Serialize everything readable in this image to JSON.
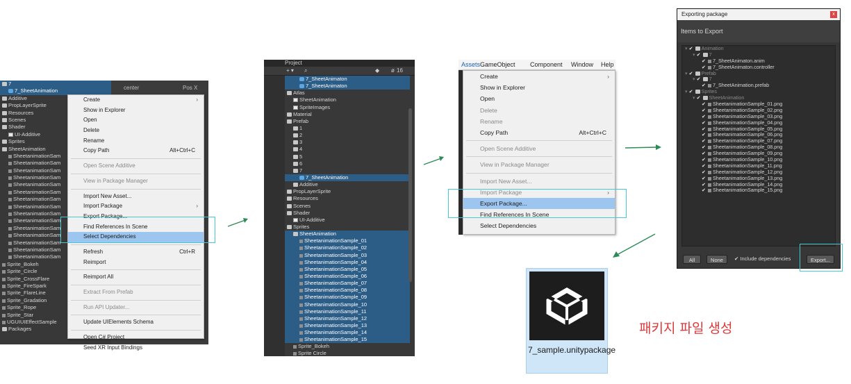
{
  "panel1": {
    "tree": [
      {
        "label": "7",
        "icon": "folder",
        "indent": 0,
        "sel": true
      },
      {
        "label": "7_SheetAnimation",
        "icon": "prefab",
        "indent": 1,
        "sel": true
      },
      {
        "label": "Additive",
        "icon": "folder",
        "indent": 0
      },
      {
        "label": "PropLayerSprite",
        "icon": "folder",
        "indent": 0
      },
      {
        "label": "Resources",
        "icon": "folder",
        "indent": 0
      },
      {
        "label": "Scenes",
        "icon": "folder",
        "indent": 0
      },
      {
        "label": "Shader",
        "icon": "folder",
        "indent": 0
      },
      {
        "label": "UI-Additive",
        "icon": "file",
        "indent": 1
      },
      {
        "label": "Sprites",
        "icon": "folder",
        "indent": 0
      },
      {
        "label": "SheetAnimation",
        "icon": "folder",
        "indent": 0
      },
      {
        "label": "SheetanimationSam",
        "icon": "small",
        "indent": 1
      },
      {
        "label": "SheetanimationSam",
        "icon": "small",
        "indent": 1
      },
      {
        "label": "SheetanimationSam",
        "icon": "small",
        "indent": 1
      },
      {
        "label": "SheetanimationSam",
        "icon": "small",
        "indent": 1
      },
      {
        "label": "SheetanimationSam",
        "icon": "small",
        "indent": 1
      },
      {
        "label": "SheetanimationSam",
        "icon": "small",
        "indent": 1
      },
      {
        "label": "SheetanimationSam",
        "icon": "small",
        "indent": 1
      },
      {
        "label": "SheetanimationSam",
        "icon": "small",
        "indent": 1
      },
      {
        "label": "SheetanimationSam",
        "icon": "small",
        "indent": 1
      },
      {
        "label": "SheetanimationSam",
        "icon": "small",
        "indent": 1
      },
      {
        "label": "SheetanimationSam",
        "icon": "small",
        "indent": 1
      },
      {
        "label": "SheetanimationSam",
        "icon": "small",
        "indent": 1
      },
      {
        "label": "SheetanimationSam",
        "icon": "small",
        "indent": 1
      },
      {
        "label": "SheetanimationSam",
        "icon": "small",
        "indent": 1
      },
      {
        "label": "SheetanimationSam",
        "icon": "small",
        "indent": 1
      },
      {
        "label": "Sprite_Bokeh",
        "icon": "small",
        "indent": 0
      },
      {
        "label": "Sprite_Circle",
        "icon": "small",
        "indent": 0
      },
      {
        "label": "Sprite_CrossFlare",
        "icon": "small",
        "indent": 0
      },
      {
        "label": "Sprite_FireSpark",
        "icon": "small",
        "indent": 0
      },
      {
        "label": "Sprite_FlareLine",
        "icon": "small",
        "indent": 0
      },
      {
        "label": "Sprite_Gradation",
        "icon": "small",
        "indent": 0
      },
      {
        "label": "Sprite_Rope",
        "icon": "small",
        "indent": 0
      },
      {
        "label": "Sprite_Star",
        "icon": "small",
        "indent": 0
      },
      {
        "label": "UGUIUIEffectSample",
        "icon": "small",
        "indent": 0
      },
      {
        "label": "Packages",
        "icon": "folder",
        "indent": 0
      }
    ],
    "inspector_center": "center",
    "inspector_pos": "Pos X",
    "menu": [
      {
        "label": "Create",
        "arrow": "›"
      },
      {
        "label": "Show in Explorer"
      },
      {
        "label": "Open"
      },
      {
        "label": "Delete"
      },
      {
        "label": "Rename"
      },
      {
        "label": "Copy Path",
        "shortcut": "Alt+Ctrl+C"
      },
      {
        "sep": true
      },
      {
        "label": "Open Scene Additive",
        "disabled": true
      },
      {
        "sep": true
      },
      {
        "label": "View in Package Manager",
        "disabled": true
      },
      {
        "sep": true
      },
      {
        "label": "Import New Asset..."
      },
      {
        "label": "Import Package",
        "arrow": "›"
      },
      {
        "label": "Export Package..."
      },
      {
        "label": "Find References In Scene"
      },
      {
        "label": "Select Dependencies",
        "highlight": true
      },
      {
        "sep": true
      },
      {
        "label": "Refresh",
        "shortcut": "Ctrl+R"
      },
      {
        "label": "Reimport"
      },
      {
        "sep": true
      },
      {
        "label": "Reimport All"
      },
      {
        "sep": true
      },
      {
        "label": "Extract From Prefab",
        "disabled": true
      },
      {
        "sep": true
      },
      {
        "label": "Run API Updater...",
        "disabled": true
      },
      {
        "sep": true
      },
      {
        "label": "Update UIElements Schema"
      },
      {
        "sep": true
      },
      {
        "label": "Open C# Project"
      },
      {
        "label": "Seed XR Input Bindings"
      }
    ]
  },
  "panel2": {
    "tab": "Project",
    "search_count": "16",
    "tree": [
      {
        "label": "7_SheetAnimaton",
        "icon": "prefab",
        "indent": 2,
        "sel": true
      },
      {
        "label": "7_SheetAnimaton",
        "icon": "prefab",
        "indent": 2,
        "sel": true
      },
      {
        "label": "Atlas",
        "icon": "folder",
        "indent": 0
      },
      {
        "label": "SheetAnimation",
        "icon": "file",
        "indent": 1
      },
      {
        "label": "SpriteImages",
        "icon": "file",
        "indent": 1
      },
      {
        "label": "Material",
        "icon": "folder",
        "indent": 0
      },
      {
        "label": "Prefab",
        "icon": "folder",
        "indent": 0
      },
      {
        "label": "1",
        "icon": "folder",
        "indent": 1
      },
      {
        "label": "2",
        "icon": "folder",
        "indent": 1
      },
      {
        "label": "3",
        "icon": "folder",
        "indent": 1
      },
      {
        "label": "4",
        "icon": "folder",
        "indent": 1
      },
      {
        "label": "5",
        "icon": "folder",
        "indent": 1
      },
      {
        "label": "6",
        "icon": "folder",
        "indent": 1
      },
      {
        "label": "7",
        "icon": "folder",
        "indent": 1
      },
      {
        "label": "7_SheetAnimation",
        "icon": "prefab",
        "indent": 2,
        "sel": true
      },
      {
        "label": "Additive",
        "icon": "folder",
        "indent": 1
      },
      {
        "label": "PropLayerSprite",
        "icon": "folder",
        "indent": 0
      },
      {
        "label": "Resources",
        "icon": "folder",
        "indent": 0
      },
      {
        "label": "Scenes",
        "icon": "folder",
        "indent": 0
      },
      {
        "label": "Shader",
        "icon": "folder",
        "indent": 0
      },
      {
        "label": "UI-Additive",
        "icon": "file",
        "indent": 1
      },
      {
        "label": "Sprites",
        "icon": "folder",
        "indent": 0
      },
      {
        "label": "SheetAnimation",
        "icon": "folder",
        "indent": 1,
        "sel": true
      },
      {
        "label": "SheetanimationSample_01",
        "icon": "small",
        "indent": 2,
        "sel": true
      },
      {
        "label": "SheetanimationSample_02",
        "icon": "small",
        "indent": 2,
        "sel": true
      },
      {
        "label": "SheetanimationSample_03",
        "icon": "small",
        "indent": 2,
        "sel": true
      },
      {
        "label": "SheetanimationSample_04",
        "icon": "small",
        "indent": 2,
        "sel": true
      },
      {
        "label": "SheetanimationSample_05",
        "icon": "small",
        "indent": 2,
        "sel": true
      },
      {
        "label": "SheetanimationSample_06",
        "icon": "small",
        "indent": 2,
        "sel": true
      },
      {
        "label": "SheetanimationSample_07",
        "icon": "small",
        "indent": 2,
        "sel": true
      },
      {
        "label": "SheetanimationSample_08",
        "icon": "small",
        "indent": 2,
        "sel": true
      },
      {
        "label": "SheetanimationSample_09",
        "icon": "small",
        "indent": 2,
        "sel": true
      },
      {
        "label": "SheetanimationSample_10",
        "icon": "small",
        "indent": 2,
        "sel": true
      },
      {
        "label": "SheetanimationSample_11",
        "icon": "small",
        "indent": 2,
        "sel": true
      },
      {
        "label": "SheetanimationSample_12",
        "icon": "small",
        "indent": 2,
        "sel": true
      },
      {
        "label": "SheetanimationSample_13",
        "icon": "small",
        "indent": 2,
        "sel": true
      },
      {
        "label": "SheetanimationSample_14",
        "icon": "small",
        "indent": 2,
        "sel": true
      },
      {
        "label": "SheetanimationSample_15",
        "icon": "small",
        "indent": 2,
        "sel": true
      },
      {
        "label": "Sprite_Bokeh",
        "icon": "small",
        "indent": 1
      },
      {
        "label": "Sprite Circle",
        "icon": "small",
        "indent": 1
      }
    ]
  },
  "panel3": {
    "menubar": [
      "Assets",
      "GameObject",
      "Component",
      "Window",
      "Help"
    ],
    "menu": [
      {
        "label": "Create",
        "arrow": "›"
      },
      {
        "label": "Show in Explorer"
      },
      {
        "label": "Open"
      },
      {
        "label": "Delete",
        "disabled": true
      },
      {
        "label": "Rename",
        "disabled": true
      },
      {
        "label": "Copy Path",
        "shortcut": "Alt+Ctrl+C"
      },
      {
        "sep": true
      },
      {
        "label": "Open Scene Additive",
        "disabled": true
      },
      {
        "sep": true
      },
      {
        "label": "View in Package Manager",
        "disabled": true
      },
      {
        "sep": true
      },
      {
        "label": "Import New Asset...",
        "disabled": true
      },
      {
        "label": "Import Package",
        "arrow": "›",
        "disabled": true
      },
      {
        "label": "Export Package...",
        "highlight": true
      },
      {
        "label": "Find References In Scene"
      },
      {
        "label": "Select Dependencies"
      }
    ]
  },
  "panel4": {
    "title": "Exporting package",
    "close": "x",
    "header": "Items to Export",
    "items": [
      {
        "label": "Animation",
        "indent": 0,
        "gray": true,
        "folder": true
      },
      {
        "label": "7",
        "indent": 1,
        "gray": true,
        "folder": true
      },
      {
        "label": "7_SheetAnimaton.anim",
        "indent": 2
      },
      {
        "label": "7_SheetAnimaton.controller",
        "indent": 2
      },
      {
        "label": "Prefab",
        "indent": 0,
        "gray": true,
        "folder": true
      },
      {
        "label": "7",
        "indent": 1,
        "gray": true,
        "folder": true
      },
      {
        "label": "7_SheetAnimation.prefab",
        "indent": 2
      },
      {
        "label": "Sprites",
        "indent": 0,
        "gray": true,
        "folder": true
      },
      {
        "label": "SheetAnimation",
        "indent": 1,
        "gray": true,
        "folder": true
      },
      {
        "label": "SheetanimationSample_01.png",
        "indent": 2
      },
      {
        "label": "SheetanimationSample_02.png",
        "indent": 2
      },
      {
        "label": "SheetanimationSample_03.png",
        "indent": 2
      },
      {
        "label": "SheetanimationSample_04.png",
        "indent": 2
      },
      {
        "label": "SheetanimationSample_05.png",
        "indent": 2
      },
      {
        "label": "SheetanimationSample_06.png",
        "indent": 2
      },
      {
        "label": "SheetanimationSample_07.png",
        "indent": 2
      },
      {
        "label": "SheetanimationSample_08.png",
        "indent": 2
      },
      {
        "label": "SheetanimationSample_09.png",
        "indent": 2
      },
      {
        "label": "SheetanimationSample_10.png",
        "indent": 2
      },
      {
        "label": "SheetanimationSample_11.png",
        "indent": 2
      },
      {
        "label": "SheetanimationSample_12.png",
        "indent": 2
      },
      {
        "label": "SheetanimationSample_13.png",
        "indent": 2
      },
      {
        "label": "SheetanimationSample_14.png",
        "indent": 2
      },
      {
        "label": "SheetanimationSample_15.png",
        "indent": 2
      }
    ],
    "btn_all": "All",
    "btn_none": "None",
    "include_deps": "Include dependencies",
    "btn_export": "Export..."
  },
  "panel5": {
    "filename": "7_sample.unitypackage"
  },
  "caption": "패키지 파일 생성",
  "colors": {
    "accent": "#45c9d6",
    "arrow": "#2e8b57",
    "caption": "#e0383a",
    "selection": "#2c5d87"
  }
}
